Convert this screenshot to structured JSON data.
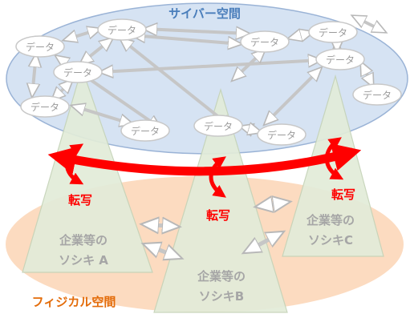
{
  "cyber_space": {
    "label": "サイバー空間",
    "color": "#4a7ebb",
    "fill": "#d6e3f3"
  },
  "physical_space": {
    "label": "フィジカル空間",
    "color": "#e36c0a",
    "fill": "#fbd5b5"
  },
  "data_node": {
    "label": "データ"
  },
  "transfer_label": "転写",
  "accent_color": "#ff0000",
  "organizations": [
    {
      "line1": "企業等の",
      "line2": "ソシキ A"
    },
    {
      "line1": "企業等の",
      "line2": "ソシキB"
    },
    {
      "line1": "企業等の",
      "line2": "ソシキC"
    }
  ]
}
